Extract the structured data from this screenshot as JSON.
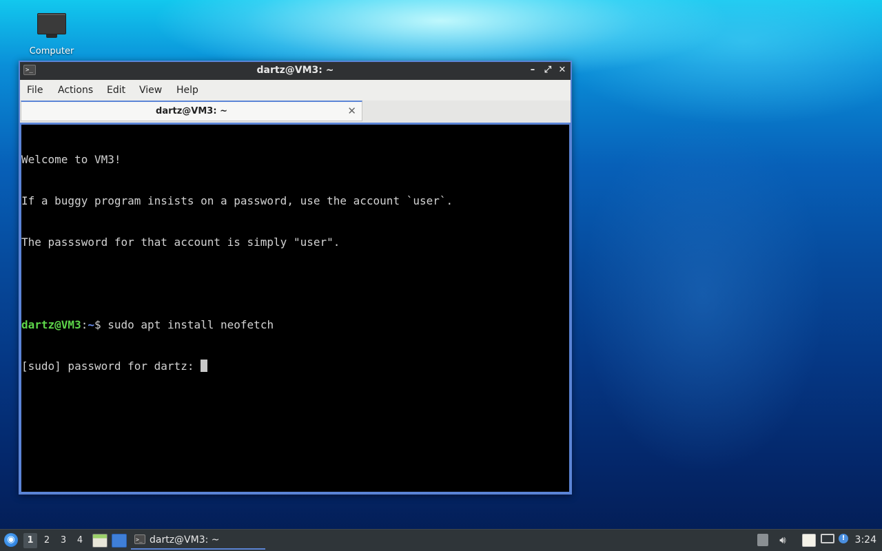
{
  "desktop": {
    "icons": [
      {
        "label": "Computer",
        "icon": "computer-icon"
      }
    ]
  },
  "window": {
    "title": "dartz@VM3: ~",
    "controls": {
      "minimize": "–",
      "maximize": "⤢",
      "close": "✕"
    },
    "menu": [
      "File",
      "Actions",
      "Edit",
      "View",
      "Help"
    ],
    "tab": {
      "title": "dartz@VM3: ~",
      "close": "✕"
    },
    "terminal": {
      "lines": [
        "Welcome to VM3!",
        "If a buggy program insists on a password, use the account `user`.",
        "The passsword for that account is simply \"user\"."
      ],
      "prompt_user": "dartz@VM3",
      "prompt_sep": ":",
      "prompt_path": "~",
      "prompt_symbol": "$",
      "command": " sudo apt install neofetch",
      "sudo_prompt": "[sudo] password for dartz: "
    },
    "colors": {
      "border_accent": "#5b84d6",
      "prompt_user": "#5dd64a",
      "prompt_path": "#6c8ff0"
    }
  },
  "taskbar": {
    "workspaces": [
      "1",
      "2",
      "3",
      "4"
    ],
    "active_workspace": "1",
    "task": {
      "label": "dartz@VM3: ~",
      "icon": "terminal-icon"
    },
    "clock": "3:24"
  }
}
